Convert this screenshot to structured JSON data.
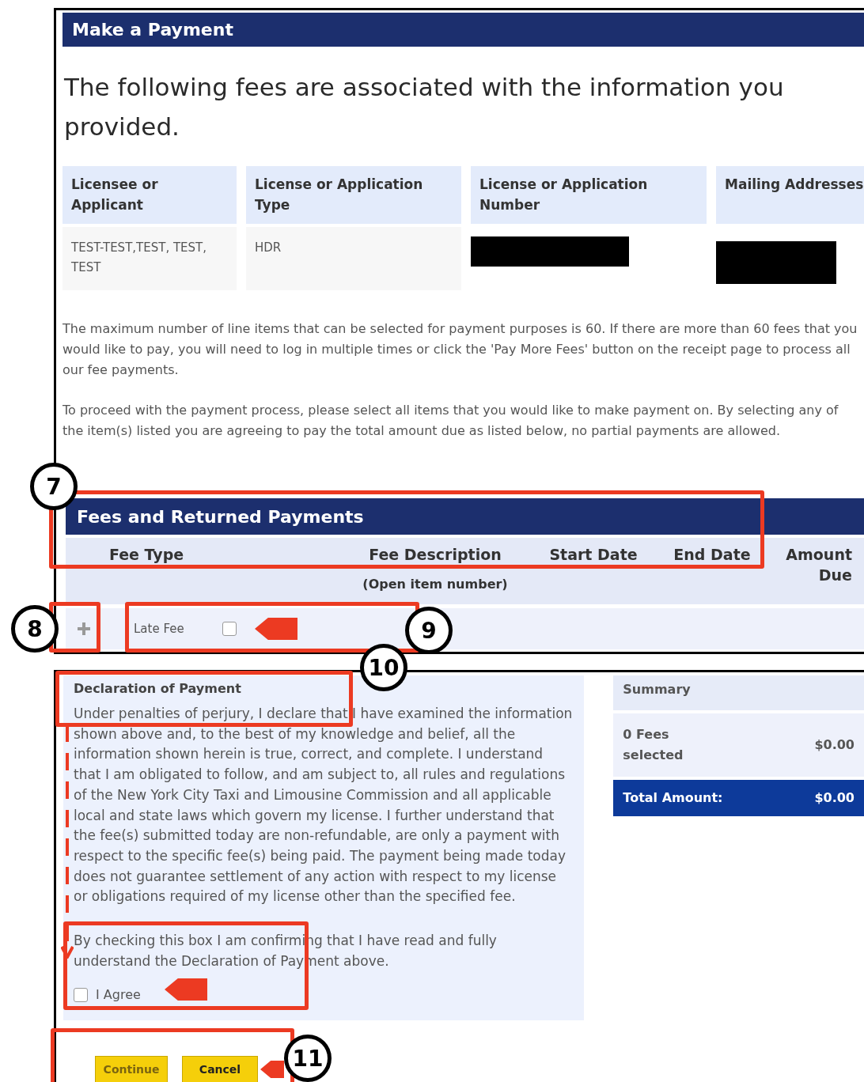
{
  "title": "Make a Payment",
  "intro": "The following fees are associated with the information you provided.",
  "licensee_table": {
    "columns": [
      "Licensee or Applicant",
      "License or Application Type",
      "License or Application Number",
      "Mailing Addresses"
    ],
    "row": [
      {
        "kind": "text",
        "text": "TEST-TEST,TEST, TEST, TEST"
      },
      {
        "kind": "text",
        "text": "HDR"
      },
      {
        "kind": "redacted"
      },
      {
        "kind": "redacted"
      }
    ]
  },
  "notes": [
    "The maximum number of line items that can be selected for payment purposes is 60. If there are more than 60 fees that you would like to pay, you will need to log in multiple times or click the 'Pay More Fees' button on the receipt page to process all our fee payments.",
    "To proceed with the payment process, please select all items that you would like to make payment on. By selecting any of the item(s) listed you are agreeing to pay the total amount due as listed below, no partial payments are allowed."
  ],
  "fees": {
    "title": "Fees and Returned Payments",
    "columns": [
      {
        "label": "Fee Type"
      },
      {
        "label": "Fee Description",
        "sublabel": "(Open item number)"
      },
      {
        "label": "Start Date"
      },
      {
        "label": "End Date"
      },
      {
        "label": "Amount Due"
      }
    ],
    "rows": [
      {
        "fee_type": "Late Fee",
        "checked": false
      }
    ]
  },
  "declaration": {
    "title": "Declaration of Payment",
    "text": "Under penalties of perjury, I declare that I have examined the information shown above and, to the best of my knowledge and belief, all the information shown herein is true, correct, and complete. I understand that I am obligated to follow, and am subject to, all rules and regulations of the New York City Taxi and Limousine Commission and all applicable local and state laws which govern my license. I further understand that the fee(s) submitted today are non-refundable, are only a payment with respect to the specific fee(s) being paid. The payment being made today does not guarantee settlement of any action with respect to my license or obligations required of my license other than the specified fee.",
    "confirm_text": "By checking this box I am confirming that I have read and fully understand the Declaration of Payment above.",
    "agree": {
      "label": "I Agree",
      "checked": false
    }
  },
  "summary": {
    "title": "Summary",
    "count": "0 Fees selected",
    "count_amount": "$0.00",
    "total_label": "Total Amount:",
    "total": "$0.00"
  },
  "buttons": [
    {
      "label": "Continue",
      "disabled": true
    },
    {
      "label": "Cancel",
      "disabled": false
    }
  ],
  "annotations": [
    {
      "label": "7"
    },
    {
      "label": "8"
    },
    {
      "label": "9"
    },
    {
      "label": "10"
    },
    {
      "label": "11"
    }
  ]
}
